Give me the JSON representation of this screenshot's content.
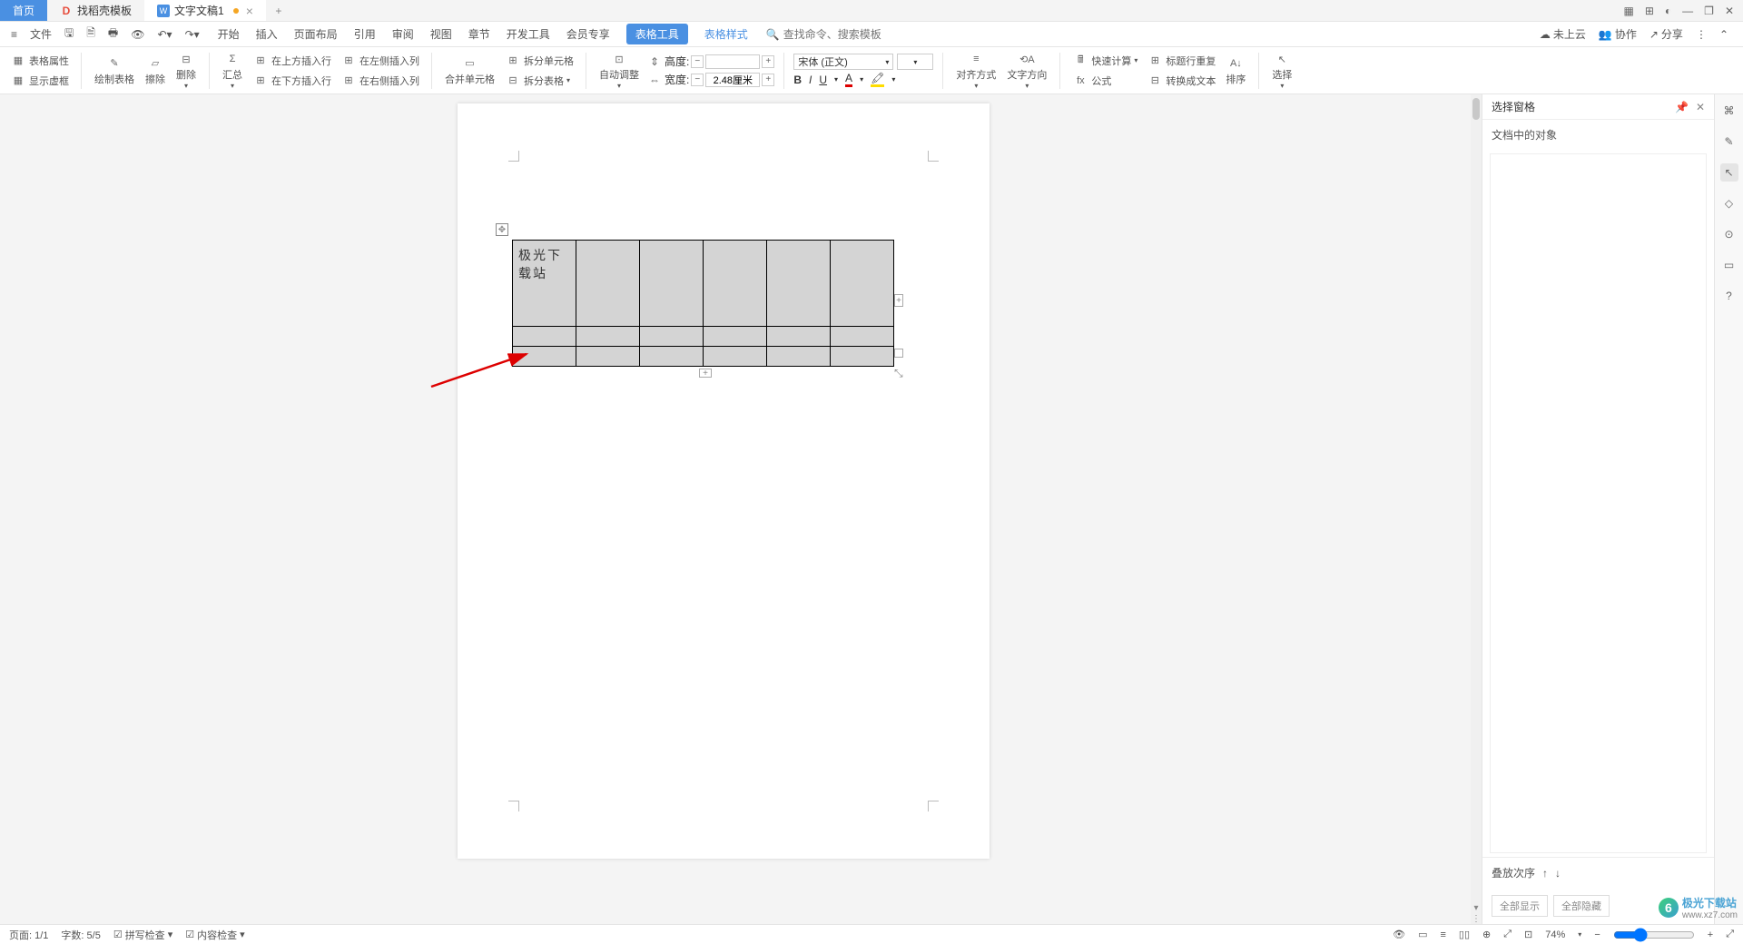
{
  "tabs": {
    "home": "首页",
    "templates": "找稻壳模板",
    "doc": "文字文稿1"
  },
  "win": {
    "grid": "▦",
    "apps": "⊞",
    "avatar": "◐",
    "min": "—",
    "max": "❐",
    "close": "✕"
  },
  "menu": {
    "file": "文件",
    "items": [
      "开始",
      "插入",
      "页面布局",
      "引用",
      "审阅",
      "视图",
      "章节",
      "开发工具",
      "会员专享"
    ],
    "active": "表格工具",
    "link": "表格样式",
    "search_icon": "🔍",
    "search_placeholder": "查找命令、搜索模板",
    "cloud": "未上云",
    "collab": "协作",
    "share": "分享"
  },
  "ribbon": {
    "props": "表格属性",
    "showframe": "显示虚框",
    "draw": "绘制表格",
    "erase": "擦除",
    "delete": "删除",
    "summary": "汇总",
    "ins_above": "在上方插入行",
    "ins_below": "在下方插入行",
    "ins_left": "在左侧插入列",
    "ins_right": "在右侧插入列",
    "merge": "合并单元格",
    "split_cell": "拆分单元格",
    "split_table": "拆分表格",
    "autofit": "自动调整",
    "height_lbl": "高度:",
    "height_val": "",
    "width_lbl": "宽度:",
    "width_val": "2.48厘米",
    "font": "宋体 (正文)",
    "font_size": "",
    "bold": "B",
    "italic": "I",
    "underline": "U",
    "align": "对齐方式",
    "textdir": "文字方向",
    "quickcalc": "快速计算",
    "formula": "公式",
    "headerrepeat": "标题行重复",
    "totext": "转换成文本",
    "sort": "排序",
    "select": "选择"
  },
  "table_cell": "极光下载站",
  "panel": {
    "title": "选择窗格",
    "sub": "文档中的对象",
    "order": "叠放次序",
    "showall": "全部显示",
    "hideall": "全部隐藏"
  },
  "status": {
    "page": "页面: 1/1",
    "words": "字数: 5/5",
    "spell": "拼写检查",
    "content": "内容检查",
    "zoom": "74%"
  },
  "watermark": {
    "title": "极光下载站",
    "sub": "www.xz7.com"
  }
}
